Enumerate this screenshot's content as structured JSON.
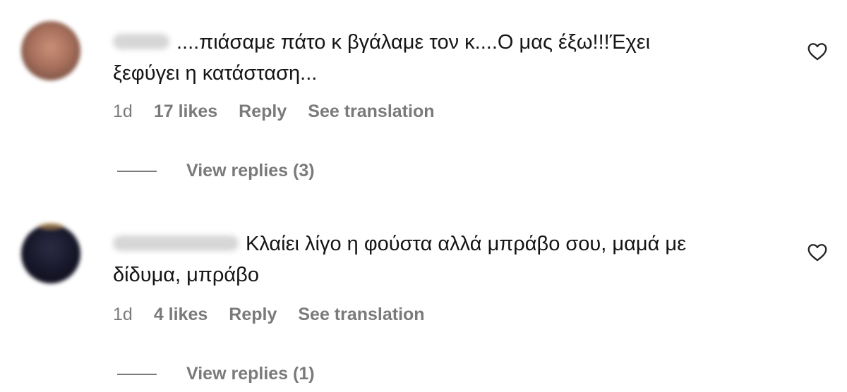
{
  "comments": [
    {
      "line1": "....πιάσαμε πάτο κ βγάλαμε τον κ....Ο μας έξω!!!Έχει",
      "line2": "ξεφύγει η κατάσταση...",
      "age": "1d",
      "likes": "17 likes",
      "reply_label": "Reply",
      "translate_label": "See translation",
      "view_replies": "View replies (3)",
      "icon": "heart-outline"
    },
    {
      "line1": "Κλαίει λίγο η φούστα αλλά μπράβο σου, μαμά με",
      "line2": "δίδυμα, μπράβο",
      "age": "1d",
      "likes": "4 likes",
      "reply_label": "Reply",
      "translate_label": "See translation",
      "view_replies": "View replies (1)",
      "icon": "heart-outline"
    }
  ],
  "colors": {
    "text": "#151515",
    "meta": "#7a7a7a",
    "background": "#ffffff"
  }
}
